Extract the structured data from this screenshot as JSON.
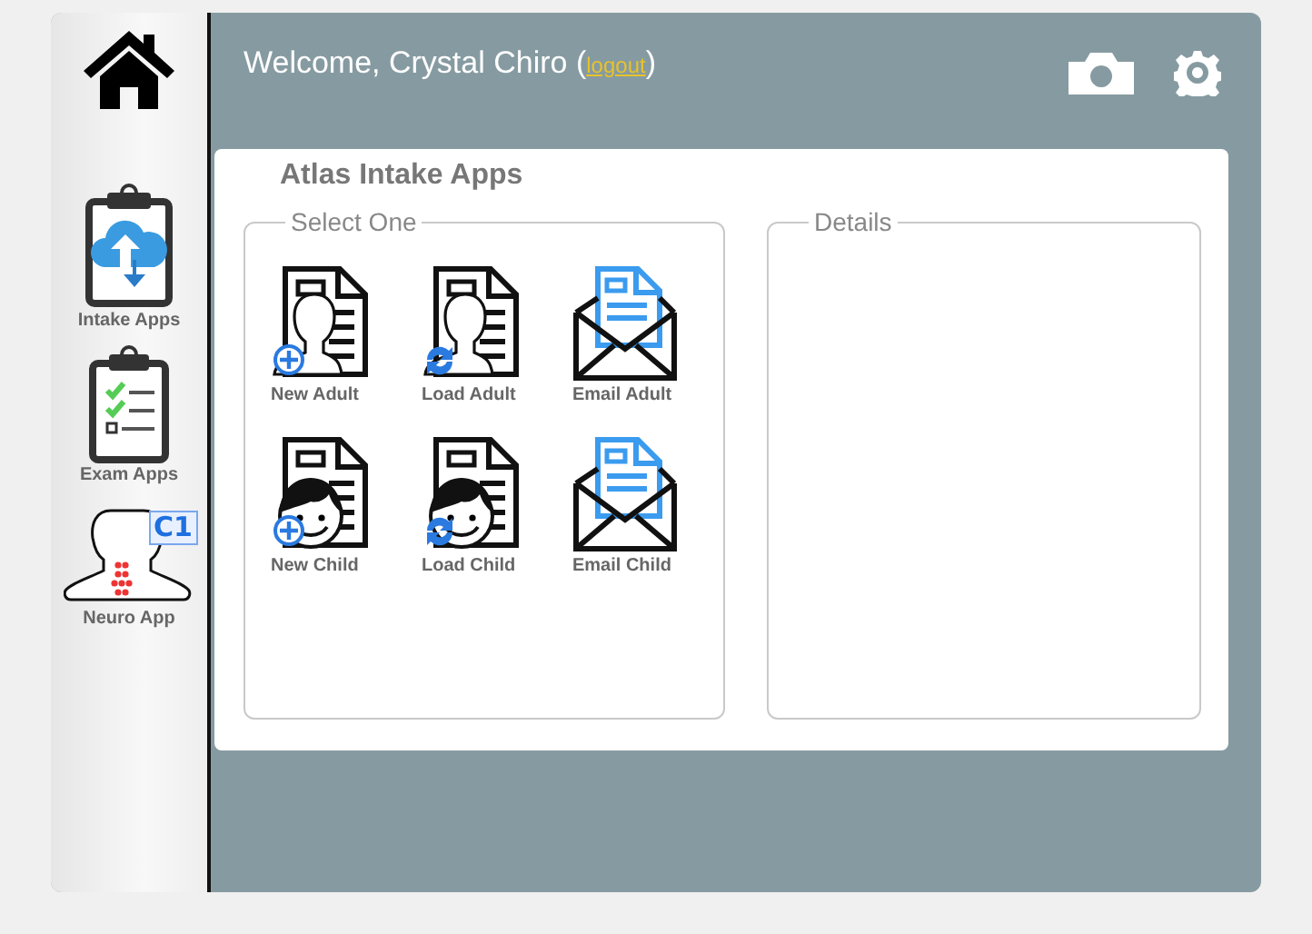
{
  "header": {
    "welcome": "Welcome, Crystal Chiro (",
    "logout": "logout",
    "close_paren": ")"
  },
  "sidebar": {
    "items": [
      {
        "kind": "home"
      },
      {
        "kind": "intake",
        "label": "Intake Apps"
      },
      {
        "kind": "exam",
        "label": "Exam Apps"
      },
      {
        "kind": "neuro",
        "label": "Neuro App",
        "badge": "C1"
      }
    ]
  },
  "card": {
    "title": "Atlas Intake Apps",
    "select_panel": {
      "legend": "Select One",
      "apps": [
        {
          "kind": "newadult",
          "label": "New Adult"
        },
        {
          "kind": "loadadult",
          "label": "Load Adult"
        },
        {
          "kind": "email",
          "label": "Email Adult"
        },
        {
          "kind": "newchild",
          "label": "New Child"
        },
        {
          "kind": "loadchild",
          "label": "Load Child"
        },
        {
          "kind": "email",
          "label": "Email Child"
        }
      ]
    },
    "details_panel": {
      "legend": "Details"
    }
  }
}
